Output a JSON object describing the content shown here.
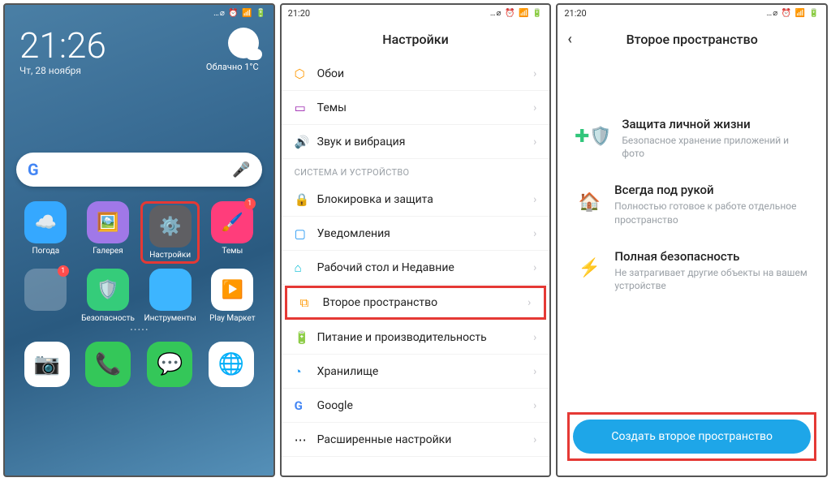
{
  "status": {
    "time_left": "21:20",
    "icons": "…⌀ ⏰ 📶 🔋"
  },
  "screen1": {
    "clock": "21:26",
    "date": "Чт, 28 ноября",
    "weather": "Облачно 1°C",
    "apps_row1": [
      {
        "label": "Погода"
      },
      {
        "label": "Галерея"
      },
      {
        "label": "Настройки"
      },
      {
        "label": "Темы",
        "badge": "1"
      }
    ],
    "apps_row2": [
      {
        "label": "",
        "badge": "1"
      },
      {
        "label": "Безопасность"
      },
      {
        "label": "Инструменты"
      },
      {
        "label": "Play Маркет"
      }
    ]
  },
  "screen2": {
    "title": "Настройки",
    "section": "СИСТЕМА И УСТРОЙСТВО",
    "rows": [
      "Обои",
      "Темы",
      "Звук и вибрация",
      "Блокировка и защита",
      "Уведомления",
      "Рабочий стол и Недавние",
      "Второе пространство",
      "Питание и производительность",
      "Хранилище",
      "Google",
      "Расширенные настройки"
    ]
  },
  "screen3": {
    "title": "Второе пространство",
    "features": [
      {
        "h": "Защита личной жизни",
        "p": "Безопасное хранение приложений и фото"
      },
      {
        "h": "Всегда под рукой",
        "p": "Полностью готовое к работе отдельное пространство"
      },
      {
        "h": "Полная безопасность",
        "p": "Не затрагивает другие объекты на вашем устройстве"
      }
    ],
    "cta": "Создать второе пространство"
  }
}
